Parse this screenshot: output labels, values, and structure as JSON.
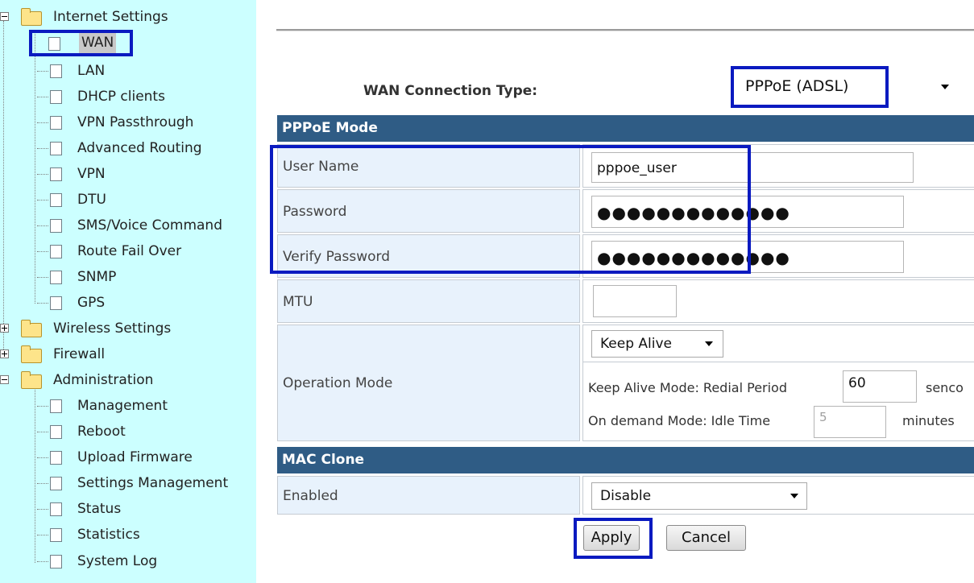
{
  "nav": {
    "internet_settings": "Internet Settings",
    "internet_items": [
      "WAN",
      "LAN",
      "DHCP clients",
      "VPN Passthrough",
      "Advanced Routing",
      "VPN",
      "DTU",
      "SMS/Voice Command",
      "Route Fail Over",
      "SNMP",
      "GPS"
    ],
    "wireless_settings": "Wireless Settings",
    "firewall": "Firewall",
    "administration": "Administration",
    "admin_items": [
      "Management",
      "Reboot",
      "Upload Firmware",
      "Settings Management",
      "Status",
      "Statistics",
      "System Log"
    ]
  },
  "main": {
    "wan_connection_type_label": "WAN Connection Type:",
    "wan_connection_type_value": "PPPoE (ADSL)",
    "pppoe_header": "PPPoE Mode",
    "user_name_label": "User Name",
    "user_name_value": "pppoe_user",
    "password_label": "Password",
    "password_value": "●●●●●●●●●●●●●",
    "verify_password_label": "Verify Password",
    "verify_password_value": "●●●●●●●●●●●●●",
    "mtu_label": "MTU",
    "mtu_value": "",
    "operation_mode_label": "Operation Mode",
    "operation_mode_value": "Keep Alive",
    "keep_alive_text": "Keep Alive Mode: Redial Period",
    "redial_period_value": "60",
    "redial_unit": "senco",
    "on_demand_text": "On demand Mode: Idle Time",
    "idle_time_value": "5",
    "idle_unit": "minutes",
    "mac_clone_header": "MAC Clone",
    "enabled_label": "Enabled",
    "enabled_value": "Disable",
    "apply_label": "Apply",
    "cancel_label": "Cancel"
  },
  "colors": {
    "nav_bg": "#ccffff",
    "header_bg": "#2f5c85",
    "highlight": "#0a1ac0",
    "label_bg": "#e8f2fc"
  },
  "icons": [
    "folder-icon",
    "page-icon",
    "tree-toggle-icon",
    "dropdown-arrow-icon"
  ]
}
